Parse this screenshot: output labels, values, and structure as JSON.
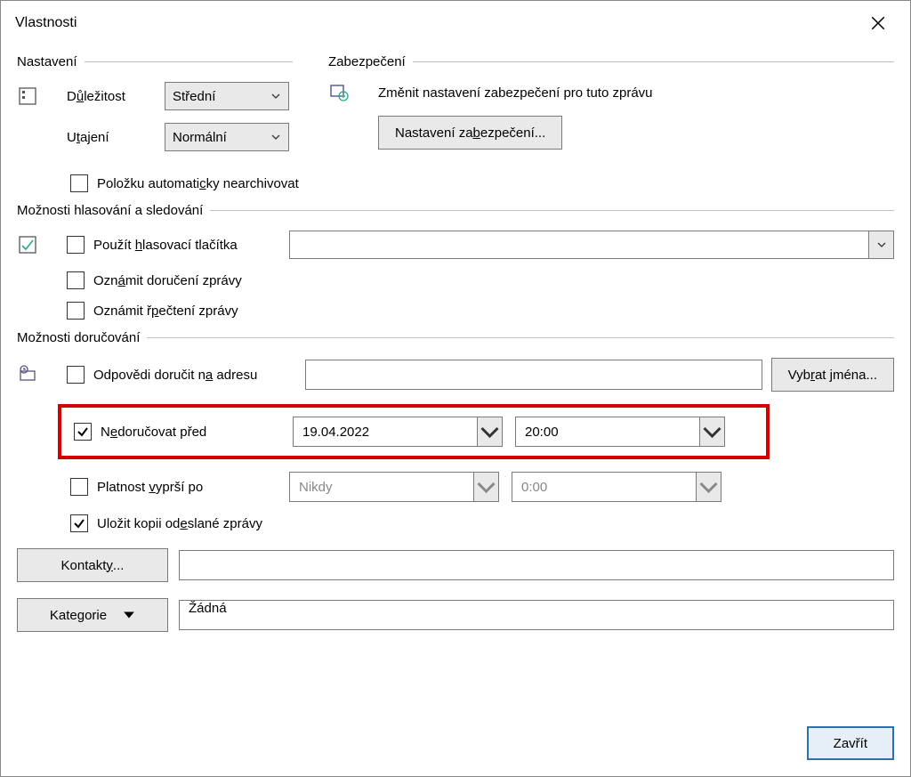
{
  "window": {
    "title": "Vlastnosti"
  },
  "settings": {
    "header": "Nastavení",
    "importance_label_pre": "D",
    "importance_label_u": "ů",
    "importance_label_post": "ležitost",
    "importance_value": "Střední",
    "sensitivity_label_pre": "U",
    "sensitivity_label_u": "t",
    "sensitivity_label_post": "ajení",
    "sensitivity_value": "Normální",
    "noarchive_pre": "Položku automati",
    "noarchive_u": "c",
    "noarchive_post": "ky nearchivovat"
  },
  "security": {
    "header": "Zabezpečení",
    "desc": "Změnit nastavení zabezpečení pro tuto zprávu",
    "btn_pre": "Nastavení za",
    "btn_u": "b",
    "btn_post": "ezpečení..."
  },
  "voting": {
    "header": "Možnosti hlasování a sledování",
    "use_buttons_pre": "Použít ",
    "use_buttons_u": "h",
    "use_buttons_post": "lasovací tlačítka",
    "delivery_receipt_pre": "Ozn",
    "delivery_receipt_u": "á",
    "delivery_receipt_post": "mit doručení zprávy",
    "read_receipt_pre": "Oznámit ",
    "read_receipt_u": "p",
    "read_receipt_mid": "ř",
    "read_receipt_post": "ečtení zprávy",
    "combo_value": ""
  },
  "delivery": {
    "header": "Možnosti doručování",
    "reply_to_pre": "Odpovědi doručit n",
    "reply_to_u": "a",
    "reply_to_post": " adresu",
    "reply_to_value": "",
    "select_names_pre": "Vyb",
    "select_names_u": "r",
    "select_names_post": "at jména...",
    "not_before_pre": "N",
    "not_before_u": "e",
    "not_before_post": "doručovat před",
    "not_before_date": "19.04.2022",
    "not_before_time": "20:00",
    "expires_pre": "Platnost ",
    "expires_u": "v",
    "expires_post": "yprší po",
    "expires_date": "Nikdy",
    "expires_time": "0:00",
    "save_copy_pre": "Uložit kopii od",
    "save_copy_u": "e",
    "save_copy_post": "slané zprávy"
  },
  "bottom": {
    "contacts_pre": "Kontakt",
    "contacts_u": "y",
    "contacts_post": "...",
    "contacts_value": "",
    "categories_label": "Kategorie",
    "categories_value": "Žádná"
  },
  "footer": {
    "close": "Zavřít"
  }
}
